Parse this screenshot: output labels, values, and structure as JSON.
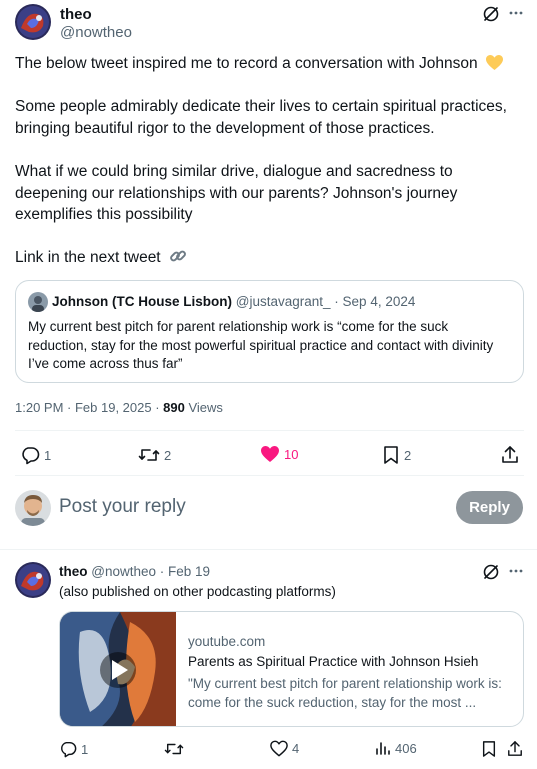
{
  "main_tweet": {
    "display_name": "theo",
    "handle": "@nowtheo",
    "paragraphs": [
      "The below tweet inspired me to record a conversation with Johnson",
      "Some people admirably dedicate their lives to certain spiritual practices, bringing beautiful rigor to the development of those practices.",
      "What if we could bring similar drive, dialogue and sacredness to deepening our relationships with our parents? Johnson's journey exemplifies this possibility",
      "Link in the next tweet"
    ],
    "timestamp": "1:20 PM · Feb 19, 2025 · ",
    "views_count": "890",
    "views_label": "Views",
    "actions": {
      "replies": "1",
      "reposts": "2",
      "likes": "10",
      "bookmarks": "2"
    }
  },
  "quoted_tweet": {
    "display_name": "Johnson (TC House Lisbon)",
    "handle": "@justavagrant_",
    "date": "· Sep 4, 2024",
    "text": "My current best pitch for parent relationship work is “come for the suck reduction, stay for the most powerful spiritual practice and contact with divinity I’ve come across thus far”"
  },
  "reply_composer": {
    "placeholder": "Post your reply",
    "button_label": "Reply"
  },
  "thread_tweet": {
    "display_name": "theo",
    "handle": "@nowtheo",
    "date": "· Feb 19",
    "text": "(also published on other podcasting platforms)",
    "card": {
      "domain": "youtube.com",
      "title": "Parents as Spiritual Practice with Johnson Hsieh",
      "description": "\"My current best pitch for parent relationship work is: come for the suck reduction, stay for the most ..."
    },
    "actions": {
      "replies": "1",
      "likes": "4",
      "views": "406"
    }
  },
  "colors": {
    "like_active": "#f91880",
    "reply_button_bg": "#8e969c",
    "text_secondary": "#536471",
    "border": "#cfd9de"
  }
}
